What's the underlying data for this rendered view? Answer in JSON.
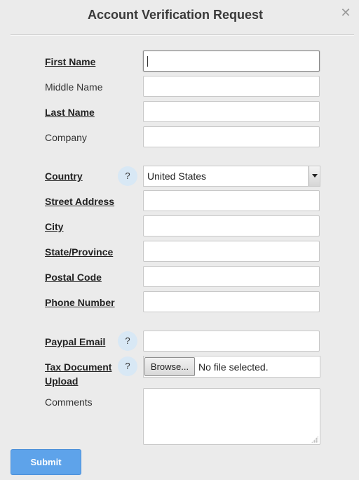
{
  "dialog": {
    "title": "Account Verification Request",
    "close_icon": "close-icon"
  },
  "fields": {
    "first_name": {
      "label": "First Name",
      "value": ""
    },
    "middle_name": {
      "label": "Middle Name",
      "value": ""
    },
    "last_name": {
      "label": "Last Name",
      "value": ""
    },
    "company": {
      "label": "Company",
      "value": ""
    },
    "country": {
      "label": "Country",
      "selected": "United States",
      "help": "?"
    },
    "street_address": {
      "label": "Street Address",
      "value": ""
    },
    "city": {
      "label": "City",
      "value": ""
    },
    "state_province": {
      "label": "State/Province",
      "value": ""
    },
    "postal_code": {
      "label": "Postal Code",
      "value": ""
    },
    "phone_number": {
      "label": "Phone Number",
      "value": ""
    },
    "paypal_email": {
      "label": "Paypal Email",
      "value": "",
      "help": "?"
    },
    "tax_document": {
      "label_line1": "Tax Document",
      "label_line2": "Upload",
      "browse_label": "Browse...",
      "status": "No file selected.",
      "help": "?"
    },
    "comments": {
      "label": "Comments",
      "value": ""
    }
  },
  "actions": {
    "submit_label": "Submit"
  },
  "colors": {
    "submit": "#5ea3ea",
    "help_bg": "#d8e8f5",
    "background": "#ebebeb"
  }
}
